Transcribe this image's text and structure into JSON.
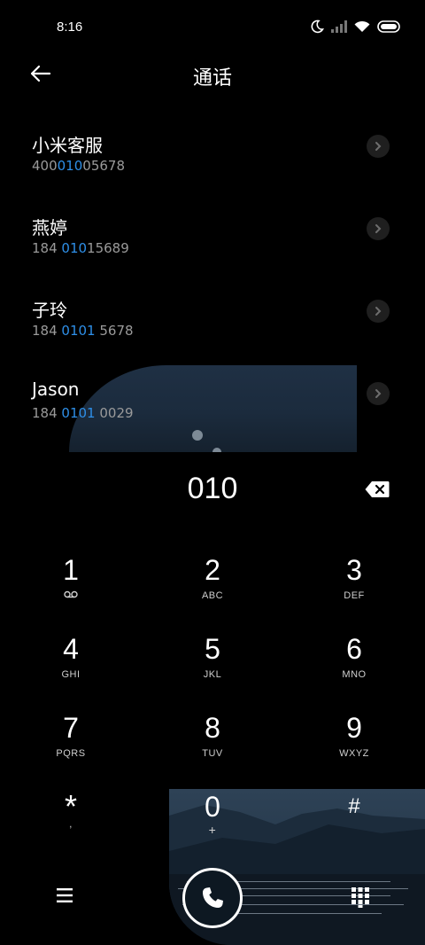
{
  "status": {
    "time": "8:16"
  },
  "header": {
    "title": "通话"
  },
  "contacts": [
    {
      "name": "小米客服",
      "num_pre": "400",
      "num_match": "010",
      "num_post": "05678"
    },
    {
      "name": "燕婷",
      "num_pre": "184 ",
      "num_match": "010",
      "num_post": "15689"
    },
    {
      "name": "子玲",
      "num_pre": "184 ",
      "num_match": "0101",
      "num_post": " 5678"
    },
    {
      "name": "Jason",
      "num_pre": "184 ",
      "num_match": "0101",
      "num_post": " 0029"
    }
  ],
  "dialer": {
    "digits": "010"
  },
  "keys": [
    {
      "num": "1",
      "letters": ""
    },
    {
      "num": "2",
      "letters": "ABC"
    },
    {
      "num": "3",
      "letters": "DEF"
    },
    {
      "num": "4",
      "letters": "GHI"
    },
    {
      "num": "5",
      "letters": "JKL"
    },
    {
      "num": "6",
      "letters": "MNO"
    },
    {
      "num": "7",
      "letters": "PQRS"
    },
    {
      "num": "8",
      "letters": "TUV"
    },
    {
      "num": "9",
      "letters": "WXYZ"
    },
    {
      "num": "*",
      "letters": ","
    },
    {
      "num": "0",
      "letters": "+"
    },
    {
      "num": "#",
      "letters": ""
    }
  ],
  "icons": {
    "back": "arrow-left-icon",
    "chevron": "chevron-right-icon",
    "backspace": "backspace-icon",
    "voicemail": "voicemail-icon",
    "menu": "menu-icon",
    "call": "phone-icon",
    "dialpad": "dialpad-icon"
  },
  "colors": {
    "match": "#2e8fe8",
    "background": "#000000"
  }
}
